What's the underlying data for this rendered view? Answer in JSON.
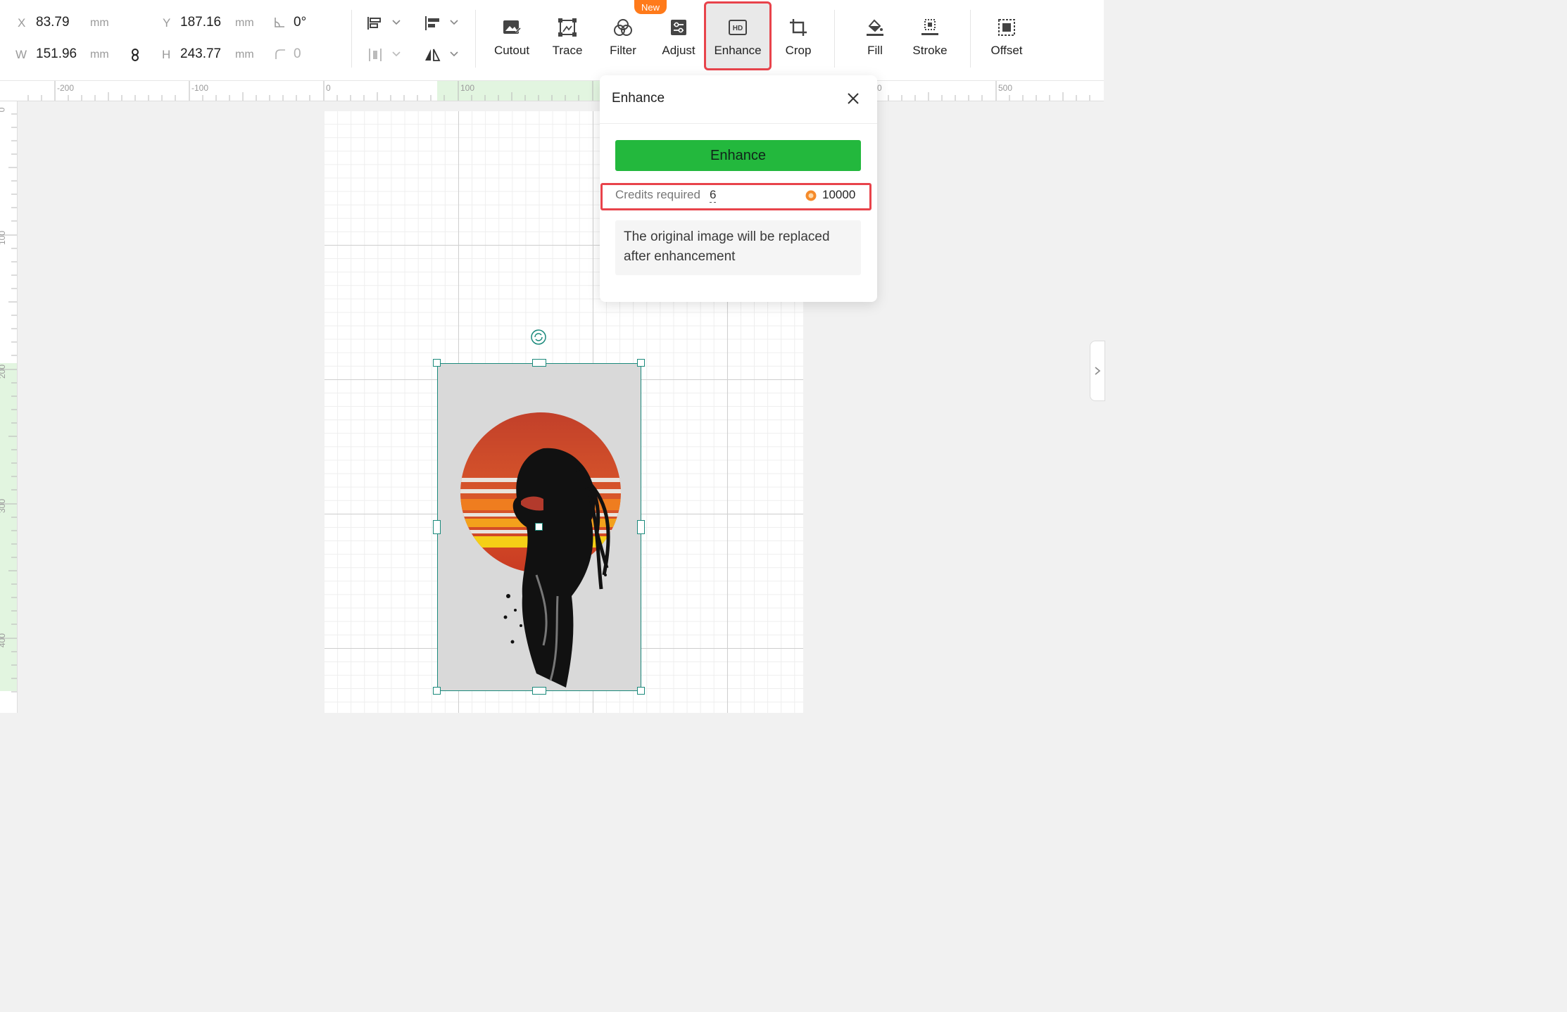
{
  "properties": {
    "x_label": "X",
    "x_value": "83.79",
    "x_unit": "mm",
    "y_label": "Y",
    "y_value": "187.16",
    "y_unit": "mm",
    "angle_value": "0°",
    "w_label": "W",
    "w_value": "151.96",
    "w_unit": "mm",
    "h_label": "H",
    "h_value": "243.77",
    "h_unit": "mm",
    "radius_value": "0"
  },
  "toolbar": {
    "new_badge": "New",
    "tools": [
      {
        "label": "Cutout",
        "icon": "cutout-icon"
      },
      {
        "label": "Trace",
        "icon": "trace-icon"
      },
      {
        "label": "Filter",
        "icon": "filter-icon"
      },
      {
        "label": "Adjust",
        "icon": "adjust-icon"
      },
      {
        "label": "Enhance",
        "icon": "hd-icon"
      },
      {
        "label": "Crop",
        "icon": "crop-icon"
      },
      {
        "label": "Fill",
        "icon": "fill-bucket-icon"
      },
      {
        "label": "Stroke",
        "icon": "stroke-icon"
      },
      {
        "label": "Offset",
        "icon": "offset-icon"
      }
    ],
    "active_tool": "Enhance",
    "accent_color": "#e8434b",
    "badge_color": "#ff7a1a"
  },
  "ruler": {
    "h_labels": [
      "-200",
      "-100",
      "0",
      "100",
      "0",
      "500"
    ],
    "v_labels": [
      "0",
      "100",
      "200",
      "300",
      "400"
    ]
  },
  "enhance_panel": {
    "title": "Enhance",
    "button_label": "Enhance",
    "credits_label": "Credits required",
    "credits_required": "6",
    "credits_balance": "10000",
    "note": "The original image will be replaced after enhancement",
    "button_color": "#23b83d"
  }
}
